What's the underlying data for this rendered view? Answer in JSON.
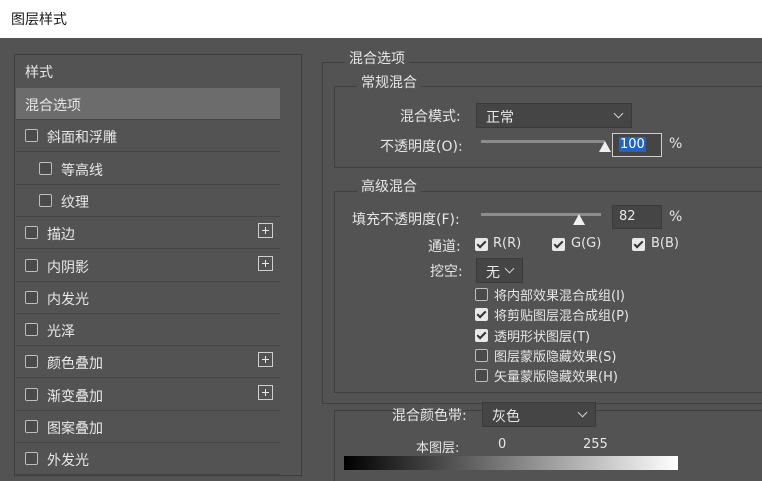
{
  "window": {
    "title": "图层样式"
  },
  "styles_panel": {
    "header": "样式",
    "items": [
      {
        "label": "混合选项",
        "checkbox": false,
        "checked": false,
        "plus": false,
        "selected": true,
        "indent": 0
      },
      {
        "label": "斜面和浮雕",
        "checkbox": true,
        "checked": false,
        "plus": false,
        "selected": false,
        "indent": 0
      },
      {
        "label": "等高线",
        "checkbox": true,
        "checked": false,
        "plus": false,
        "selected": false,
        "indent": 1
      },
      {
        "label": "纹理",
        "checkbox": true,
        "checked": false,
        "plus": false,
        "selected": false,
        "indent": 1
      },
      {
        "label": "描边",
        "checkbox": true,
        "checked": false,
        "plus": true,
        "selected": false,
        "indent": 0
      },
      {
        "label": "内阴影",
        "checkbox": true,
        "checked": false,
        "plus": true,
        "selected": false,
        "indent": 0
      },
      {
        "label": "内发光",
        "checkbox": true,
        "checked": false,
        "plus": false,
        "selected": false,
        "indent": 0
      },
      {
        "label": "光泽",
        "checkbox": true,
        "checked": false,
        "plus": false,
        "selected": false,
        "indent": 0
      },
      {
        "label": "颜色叠加",
        "checkbox": true,
        "checked": false,
        "plus": true,
        "selected": false,
        "indent": 0
      },
      {
        "label": "渐变叠加",
        "checkbox": true,
        "checked": false,
        "plus": true,
        "selected": false,
        "indent": 0
      },
      {
        "label": "图案叠加",
        "checkbox": true,
        "checked": false,
        "plus": false,
        "selected": false,
        "indent": 0
      },
      {
        "label": "外发光",
        "checkbox": true,
        "checked": false,
        "plus": false,
        "selected": false,
        "indent": 0
      }
    ]
  },
  "blend_options": {
    "title": "混合选项",
    "general": {
      "title": "常规混合",
      "mode_label": "混合模式:",
      "mode_value": "正常",
      "opacity_label": "不透明度(O):",
      "opacity_value": "100",
      "opacity_unit": "%",
      "opacity_level": 1.0
    },
    "advanced": {
      "title": "高级混合",
      "fill_label": "填充不透明度(F):",
      "fill_value": "82",
      "fill_unit": "%",
      "fill_level": 0.82,
      "channels_label": "通道:",
      "channels": [
        {
          "label": "R(R)",
          "checked": true
        },
        {
          "label": "G(G)",
          "checked": true
        },
        {
          "label": "B(B)",
          "checked": true
        }
      ],
      "knockout_label": "挖空:",
      "knockout_value": "无",
      "options": [
        {
          "label": "将内部效果混合成组(I)",
          "checked": false
        },
        {
          "label": "将剪贴图层混合成组(P)",
          "checked": true
        },
        {
          "label": "透明形状图层(T)",
          "checked": true
        },
        {
          "label": "图层蒙版隐藏效果(S)",
          "checked": false
        },
        {
          "label": "矢量蒙版隐藏效果(H)",
          "checked": false
        }
      ]
    },
    "blend_if": {
      "label": "混合颜色带:",
      "value": "灰色",
      "this_layer_label": "本图层:",
      "low": "0",
      "high": "255"
    }
  }
}
